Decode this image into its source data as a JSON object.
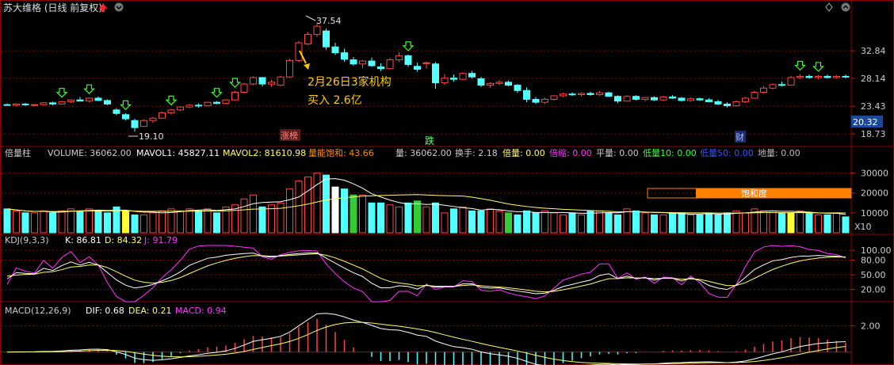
{
  "header": {
    "title": "苏大维格 (日线 前复权)",
    "price_max_label": "37.54",
    "price_min_label": "19.10",
    "annotation_line1": "2月26日3家机构",
    "annotation_line2": "买入 2.6亿",
    "tag_zhangbang": "涨榜",
    "tag_die": "跌",
    "tag_cai": "财",
    "current_price": "20.32"
  },
  "price_axis": [
    "32.84",
    "28.14",
    "23.43",
    "18.73"
  ],
  "volume_panel": {
    "name": "倍量柱",
    "vol": "VOLUME: 36062.00",
    "mavol1": "MAVOL1: 45827.11",
    "mavol2": "MAVOL2: 81610.98",
    "saturation": "量能饱和: 43.66",
    "liang": "量: 36062.00",
    "huanshou": "换手: 2.18",
    "beiliang": "倍量: 0.00",
    "beisuo": "倍缩: 0.00",
    "pingliang": "平量: 0.00",
    "diliang10": "低量10: 0.00",
    "diliang50": "低量50: 0.00",
    "diliang_di": "地量: 0.00",
    "bar_label": "饱和度",
    "axis": [
      "30000",
      "20000",
      "10000"
    ],
    "unit": "X10"
  },
  "kdj_panel": {
    "name": "KDJ(9,3,3)",
    "k": "K: 86.81",
    "d": "D: 84.32",
    "j": "J: 91.79",
    "axis": [
      "100.00",
      "80.00",
      "50.00",
      "20.00"
    ]
  },
  "macd_panel": {
    "name": "MACD(12,26,9)",
    "dif": "DIF: 0.68",
    "dea": "DEA: 0.21",
    "macd": "MACD: 0.94",
    "axis": [
      "2.00"
    ]
  },
  "colors": {
    "up": "#ff4444",
    "down": "#54ffff",
    "grid": "#8b0000",
    "k": "#ffffff",
    "d": "#ffff66",
    "j": "#ff33ff",
    "orange": "#ff7f00"
  },
  "chart_data": {
    "type": "candlestick",
    "title": "苏大维格 (日线 前复权)",
    "price_ylim": [
      17.0,
      38.5
    ],
    "candles": [
      [
        23.7,
        23.9,
        23.5,
        23.6
      ],
      [
        23.6,
        23.9,
        23.4,
        23.8
      ],
      [
        23.8,
        24.0,
        23.5,
        23.7
      ],
      [
        23.6,
        23.8,
        23.4,
        23.7
      ],
      [
        23.7,
        24.1,
        23.6,
        24.0
      ],
      [
        24.0,
        24.2,
        23.6,
        23.8
      ],
      [
        23.8,
        24.3,
        23.7,
        24.2
      ],
      [
        24.2,
        24.6,
        24.0,
        24.5
      ],
      [
        24.5,
        25.0,
        24.2,
        24.3
      ],
      [
        24.3,
        24.9,
        24.1,
        24.8
      ],
      [
        24.8,
        25.1,
        24.3,
        24.4
      ],
      [
        24.4,
        24.6,
        23.6,
        23.8
      ],
      [
        22.8,
        23.1,
        21.9,
        22.2
      ],
      [
        22.0,
        22.2,
        21.0,
        21.3
      ],
      [
        21.0,
        21.3,
        19.1,
        19.8
      ],
      [
        20.0,
        21.2,
        19.9,
        21.0
      ],
      [
        21.0,
        21.6,
        20.6,
        21.4
      ],
      [
        21.4,
        22.5,
        21.3,
        22.3
      ],
      [
        22.3,
        23.0,
        22.0,
        22.8
      ],
      [
        22.8,
        23.4,
        22.6,
        23.3
      ],
      [
        23.3,
        23.8,
        23.1,
        23.6
      ],
      [
        23.6,
        23.9,
        23.2,
        23.5
      ],
      [
        23.5,
        24.2,
        23.4,
        24.1
      ],
      [
        24.1,
        24.3,
        23.8,
        23.9
      ],
      [
        23.9,
        24.6,
        23.7,
        24.5
      ],
      [
        24.5,
        26.0,
        24.4,
        25.8
      ],
      [
        25.8,
        27.4,
        25.6,
        27.2
      ],
      [
        27.2,
        28.5,
        27.0,
        28.3
      ],
      [
        28.3,
        27.6,
        26.8,
        27.2
      ],
      [
        27.2,
        27.9,
        26.7,
        27.5
      ],
      [
        27.0,
        28.6,
        26.8,
        28.4
      ],
      [
        28.4,
        31.5,
        28.2,
        31.2
      ],
      [
        31.2,
        34.5,
        30.9,
        34.2
      ],
      [
        34.0,
        36.0,
        33.8,
        35.6
      ],
      [
        35.6,
        37.54,
        35.2,
        37.0
      ],
      [
        36.2,
        36.6,
        33.0,
        33.5
      ],
      [
        33.5,
        34.2,
        32.1,
        32.5
      ],
      [
        32.5,
        33.2,
        31.0,
        31.4
      ],
      [
        31.3,
        31.8,
        30.3,
        30.6
      ],
      [
        30.6,
        31.3,
        29.9,
        31.1
      ],
      [
        31.1,
        31.7,
        30.1,
        30.3
      ],
      [
        30.1,
        30.7,
        29.4,
        29.8
      ],
      [
        29.8,
        31.6,
        29.7,
        31.3
      ],
      [
        31.3,
        32.6,
        30.9,
        32.0
      ],
      [
        32.0,
        32.2,
        30.1,
        30.5
      ],
      [
        30.2,
        30.8,
        29.3,
        29.7
      ],
      [
        30.7,
        31.0,
        29.8,
        30.8
      ],
      [
        30.6,
        30.9,
        26.4,
        27.4
      ],
      [
        27.4,
        28.9,
        27.0,
        28.2
      ],
      [
        28.2,
        28.8,
        27.6,
        28.0
      ],
      [
        28.0,
        29.2,
        27.8,
        29.0
      ],
      [
        29.0,
        29.4,
        28.1,
        28.4
      ],
      [
        28.1,
        28.4,
        26.7,
        27.0
      ],
      [
        27.0,
        27.5,
        26.6,
        27.3
      ],
      [
        27.3,
        27.9,
        27.0,
        27.5
      ],
      [
        27.5,
        27.8,
        26.8,
        27.0
      ],
      [
        27.0,
        27.2,
        25.7,
        26.1
      ],
      [
        26.1,
        26.6,
        24.1,
        24.6
      ],
      [
        24.6,
        25.0,
        23.8,
        24.1
      ],
      [
        24.1,
        24.9,
        23.8,
        24.6
      ],
      [
        24.6,
        25.3,
        24.4,
        25.2
      ],
      [
        25.2,
        25.7,
        25.0,
        25.5
      ],
      [
        25.5,
        25.8,
        25.2,
        25.4
      ],
      [
        25.4,
        25.8,
        25.1,
        25.6
      ],
      [
        25.6,
        25.9,
        25.2,
        25.4
      ],
      [
        25.4,
        26.0,
        25.2,
        25.7
      ],
      [
        25.7,
        25.9,
        25.0,
        25.1
      ],
      [
        25.1,
        25.3,
        23.9,
        24.3
      ],
      [
        24.3,
        25.3,
        24.2,
        25.1
      ],
      [
        25.1,
        25.3,
        24.4,
        24.6
      ],
      [
        24.6,
        25.0,
        24.2,
        24.9
      ],
      [
        24.9,
        25.1,
        24.3,
        24.5
      ],
      [
        24.5,
        25.2,
        24.3,
        25.0
      ],
      [
        25.0,
        25.3,
        24.7,
        24.8
      ],
      [
        24.8,
        25.0,
        24.2,
        24.4
      ],
      [
        24.4,
        24.9,
        24.2,
        24.7
      ],
      [
        24.7,
        24.9,
        24.3,
        24.5
      ],
      [
        24.5,
        24.8,
        24.1,
        24.2
      ],
      [
        24.2,
        24.5,
        23.6,
        23.8
      ],
      [
        23.8,
        24.1,
        23.2,
        23.5
      ],
      [
        23.5,
        24.4,
        23.4,
        24.2
      ],
      [
        24.2,
        25.0,
        24.0,
        24.8
      ],
      [
        24.8,
        26.0,
        24.7,
        25.8
      ],
      [
        25.8,
        26.9,
        25.6,
        26.5
      ],
      [
        26.5,
        27.3,
        26.3,
        27.1
      ],
      [
        27.1,
        27.6,
        26.8,
        27.0
      ],
      [
        27.0,
        28.6,
        26.9,
        28.3
      ],
      [
        28.3,
        28.9,
        28.0,
        28.5
      ],
      [
        28.5,
        28.8,
        28.1,
        28.3
      ],
      [
        28.3,
        28.7,
        28.0,
        28.5
      ],
      [
        28.5,
        28.8,
        28.1,
        28.3
      ],
      [
        28.3,
        28.7,
        28.1,
        28.5
      ],
      [
        28.5,
        28.8,
        28.2,
        28.4
      ]
    ],
    "up_arrow_indices": [
      6,
      9,
      13,
      18,
      23,
      25,
      44,
      87,
      89
    ],
    "volume": [
      12,
      11,
      10,
      10,
      11,
      10,
      11,
      12,
      11,
      12,
      11,
      10,
      13,
      11,
      9,
      9,
      10,
      11,
      12,
      11,
      12,
      11,
      12,
      10,
      13,
      14,
      17,
      19,
      13,
      14,
      15,
      22,
      26,
      28,
      30,
      29,
      23,
      22,
      19,
      19,
      15,
      15,
      14,
      13,
      15,
      16,
      13,
      15,
      10,
      12,
      13,
      11,
      11,
      12,
      11,
      10,
      9,
      11,
      10,
      11,
      10,
      9,
      10,
      9,
      11,
      11,
      10,
      9,
      12,
      11,
      10,
      9,
      9,
      10,
      10,
      9,
      9,
      10,
      9,
      10,
      11,
      10,
      12,
      11,
      11,
      10,
      10,
      11,
      10,
      9,
      9,
      10,
      8
    ],
    "volume_ylim": [
      0,
      35000
    ],
    "kdj_ylim": [
      0,
      110
    ],
    "macd_ylim": [
      -0.8,
      2.8
    ]
  }
}
